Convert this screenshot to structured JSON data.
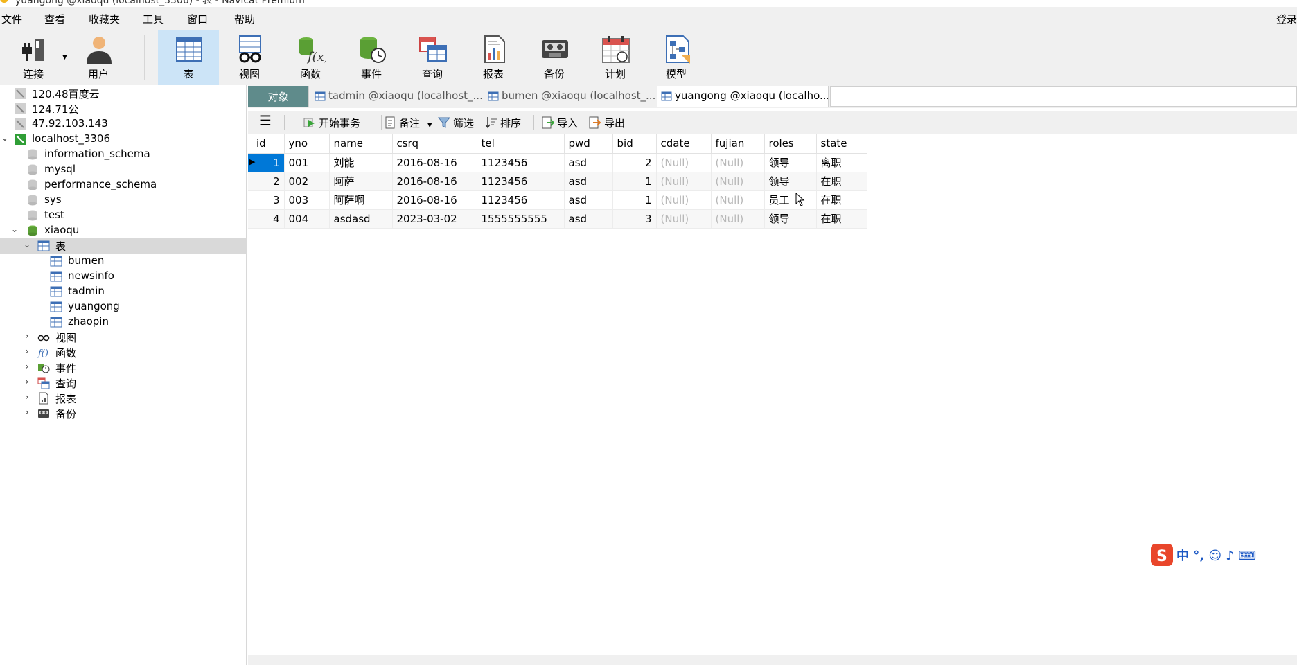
{
  "window": {
    "title": "yuangong @xiaoqu (localhost_3306) - 表 - Navicat Premium"
  },
  "menu": {
    "items": [
      "文件",
      "查看",
      "收藏夹",
      "工具",
      "窗口",
      "帮助"
    ],
    "login": "登录"
  },
  "toolbar": {
    "items": [
      {
        "label": "连接",
        "icon": "plug-icon"
      },
      {
        "label": "用户",
        "icon": "user-icon"
      },
      {
        "label": "表",
        "icon": "table-icon",
        "active": true
      },
      {
        "label": "视图",
        "icon": "view-glasses-icon"
      },
      {
        "label": "函数",
        "icon": "function-icon"
      },
      {
        "label": "事件",
        "icon": "event-clock-icon"
      },
      {
        "label": "查询",
        "icon": "query-icon"
      },
      {
        "label": "报表",
        "icon": "report-icon"
      },
      {
        "label": "备份",
        "icon": "backup-tape-icon"
      },
      {
        "label": "计划",
        "icon": "calendar-icon"
      },
      {
        "label": "模型",
        "icon": "model-icon"
      }
    ]
  },
  "sidebar": {
    "connections": [
      "120.48百度云",
      "124.71公",
      "47.92.103.143",
      "localhost_3306"
    ],
    "databases": [
      "information_schema",
      "mysql",
      "performance_schema",
      "sys",
      "test",
      "xiaoqu"
    ],
    "tables_group": "表",
    "tables": [
      "bumen",
      "newsinfo",
      "tadmin",
      "yuangong",
      "zhaopin"
    ],
    "groups": [
      "视图",
      "函数",
      "事件",
      "查询",
      "报表",
      "备份"
    ]
  },
  "tabs": {
    "objects": "对象",
    "items": [
      "tadmin @xiaoqu (localhost_...",
      "bumen @xiaoqu (localhost_...",
      "yuangong @xiaoqu (localho..."
    ]
  },
  "subtoolbar": {
    "begin_txn": "开始事务",
    "note": "备注",
    "filter": "筛选",
    "sort": "排序",
    "import": "导入",
    "export": "导出"
  },
  "grid": {
    "columns": [
      "id",
      "yno",
      "name",
      "csrq",
      "tel",
      "pwd",
      "bid",
      "cdate",
      "fujian",
      "roles",
      "state"
    ],
    "rows": [
      [
        "1",
        "001",
        "刘能",
        "2016-08-16",
        "1123456",
        "asd",
        "2",
        "(Null)",
        "(Null)",
        "领导",
        "离职"
      ],
      [
        "2",
        "002",
        "阿萨",
        "2016-08-16",
        "1123456",
        "asd",
        "1",
        "(Null)",
        "(Null)",
        "领导",
        "在职"
      ],
      [
        "3",
        "003",
        "阿萨啊",
        "2016-08-16",
        "1123456",
        "asd",
        "1",
        "(Null)",
        "(Null)",
        "员工",
        "在职"
      ],
      [
        "4",
        "004",
        "asdasd",
        "2023-03-02",
        "1555555555",
        "asd",
        "3",
        "(Null)",
        "(Null)",
        "领导",
        "在职"
      ]
    ]
  },
  "ime": {
    "text": "中 °, ☺ ♪ ⌨"
  },
  "colors": {
    "accent": "#0078d7",
    "tab_objects": "#5f8b8b",
    "toolbar_active": "#cce4f7"
  }
}
